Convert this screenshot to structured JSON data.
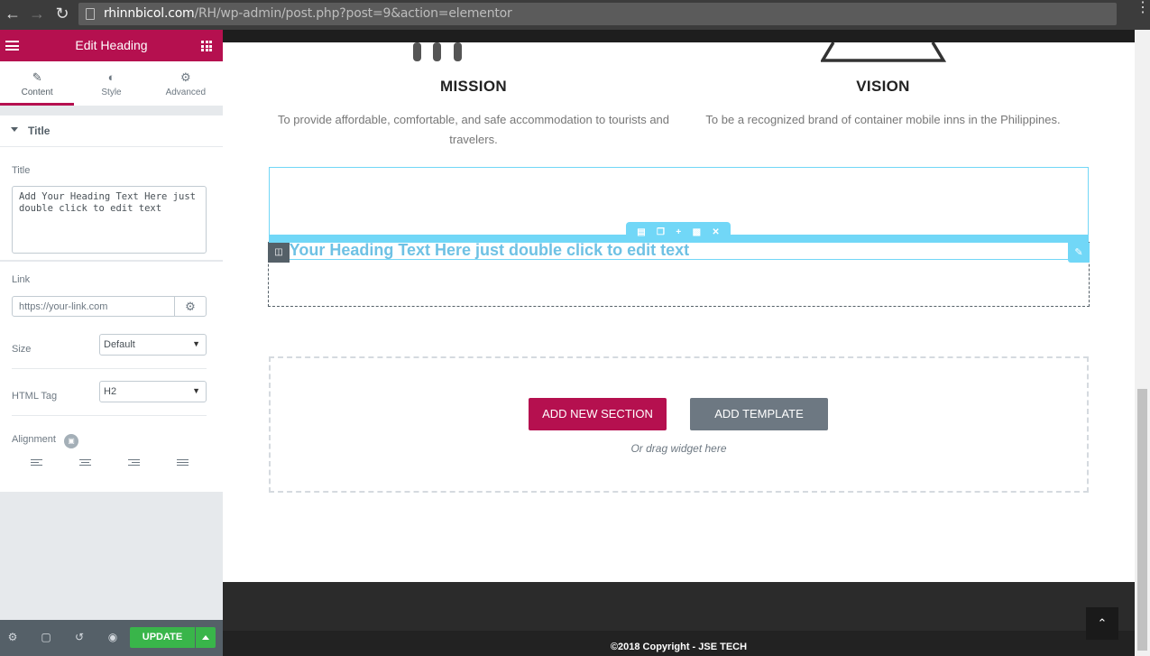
{
  "browser": {
    "url_host": "rhinnbicol.com",
    "url_path": "/RH/wp-admin/post.php?post=9&action=elementor"
  },
  "panel": {
    "header_title": "Edit Heading",
    "tabs": [
      {
        "label": "Content",
        "icon": "pencil-icon"
      },
      {
        "label": "Style",
        "icon": "contrast-icon"
      },
      {
        "label": "Advanced",
        "icon": "gear-icon"
      }
    ],
    "section_title": "Title",
    "title_label": "Title",
    "title_value": "Add Your Heading Text Here just double click to edit text",
    "link_label": "Link",
    "link_placeholder": "https://your-link.com",
    "size_label": "Size",
    "size_value": "Default",
    "html_tag_label": "HTML Tag",
    "html_tag_value": "H2",
    "alignment_label": "Alignment",
    "update_label": "UPDATE"
  },
  "preview": {
    "mission_title": "MISSION",
    "mission_text": "To provide affordable, comfortable, and safe accommodation to tourists and travelers.",
    "vision_title": "VISION",
    "vision_text": "To be a recognized brand of container mobile inns in the Philippines.",
    "heading_text": "d Your Heading Text Here just double click to edit text",
    "add_section_label": "ADD NEW SECTION",
    "add_template_label": "ADD TEMPLATE",
    "drag_hint": "Or drag widget here",
    "copyright": "©2018 Copyright - JSE TECH"
  },
  "colors": {
    "accent": "#b5104f",
    "editor_blue": "#71d7f7",
    "heading_blue": "#6ec1e4",
    "update_green": "#39b54a"
  }
}
